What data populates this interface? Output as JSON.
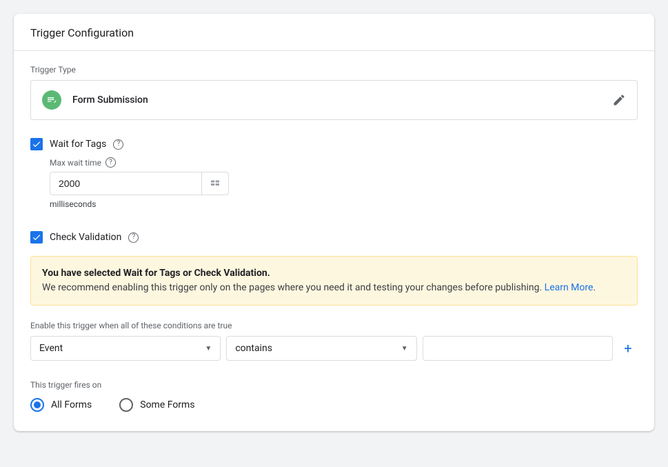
{
  "header": {
    "title": "Trigger Configuration"
  },
  "triggerType": {
    "label": "Trigger Type",
    "value": "Form Submission"
  },
  "waitForTags": {
    "label": "Wait for Tags",
    "maxWaitLabel": "Max wait time",
    "value": "2000",
    "unit": "milliseconds"
  },
  "checkValidation": {
    "label": "Check Validation"
  },
  "notice": {
    "title": "You have selected Wait for Tags or Check Validation.",
    "body": "We recommend enabling this trigger only on the pages where you need it and testing your changes before publishing. ",
    "learnMore": "Learn More",
    "period": "."
  },
  "conditions": {
    "label": "Enable this trigger when all of these conditions are true",
    "variable": "Event",
    "operator": "contains",
    "value": ""
  },
  "firesOn": {
    "label": "This trigger fires on",
    "allForms": "All Forms",
    "someForms": "Some Forms"
  }
}
